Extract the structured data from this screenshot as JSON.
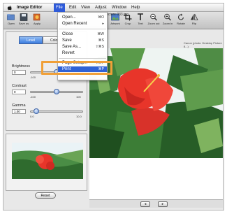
{
  "menubar": {
    "app_name": "Image Editor",
    "items": [
      "File",
      "Edit",
      "View",
      "Adjust",
      "Window",
      "Help"
    ]
  },
  "document_title": "itor - Picture 033.jpg",
  "toolbar": {
    "left_buttons": [
      "Open",
      "Save as",
      "Apply"
    ],
    "right_buttons": [
      "Artwork",
      "Crop",
      "Text",
      "Zoom out",
      "Zoom in",
      "Rotate",
      "Flip"
    ]
  },
  "status_text": "Canon (photo: Desktop Picture 8...)",
  "file_menu": {
    "items": [
      {
        "label": "Open...",
        "shortcut": "⌘O"
      },
      {
        "label": "Open Recent",
        "shortcut": "▸"
      },
      {
        "label": "Close",
        "shortcut": "⌘W"
      },
      {
        "label": "Save",
        "shortcut": "⌘S"
      },
      {
        "label": "Save As...",
        "shortcut": "⇧⌘S"
      },
      {
        "label": "Revert",
        "shortcut": ""
      },
      {
        "label": "Page Setup...",
        "shortcut": "⇧⌘P"
      },
      {
        "label": "Print",
        "shortcut": "⌘P"
      }
    ]
  },
  "adjust_panel": {
    "tabs": [
      "Level",
      "Color"
    ],
    "sliders": [
      {
        "label": "Brightness",
        "value": "0",
        "min": "-100",
        "max": "100",
        "position": 0.5
      },
      {
        "label": "Contrast",
        "value": "0",
        "min": "-100",
        "max": "100",
        "position": 0.5
      },
      {
        "label": "Gamma",
        "value": "1.00",
        "min": "0.0",
        "max": "10.0",
        "position": 0.1
      }
    ]
  },
  "reset_label": "Reset",
  "nav": {
    "prev": "◂",
    "next": "▸"
  },
  "colors": {
    "menu_highlight": "#2f62d6",
    "callout": "#f0a038",
    "flower": "#e8352a"
  }
}
